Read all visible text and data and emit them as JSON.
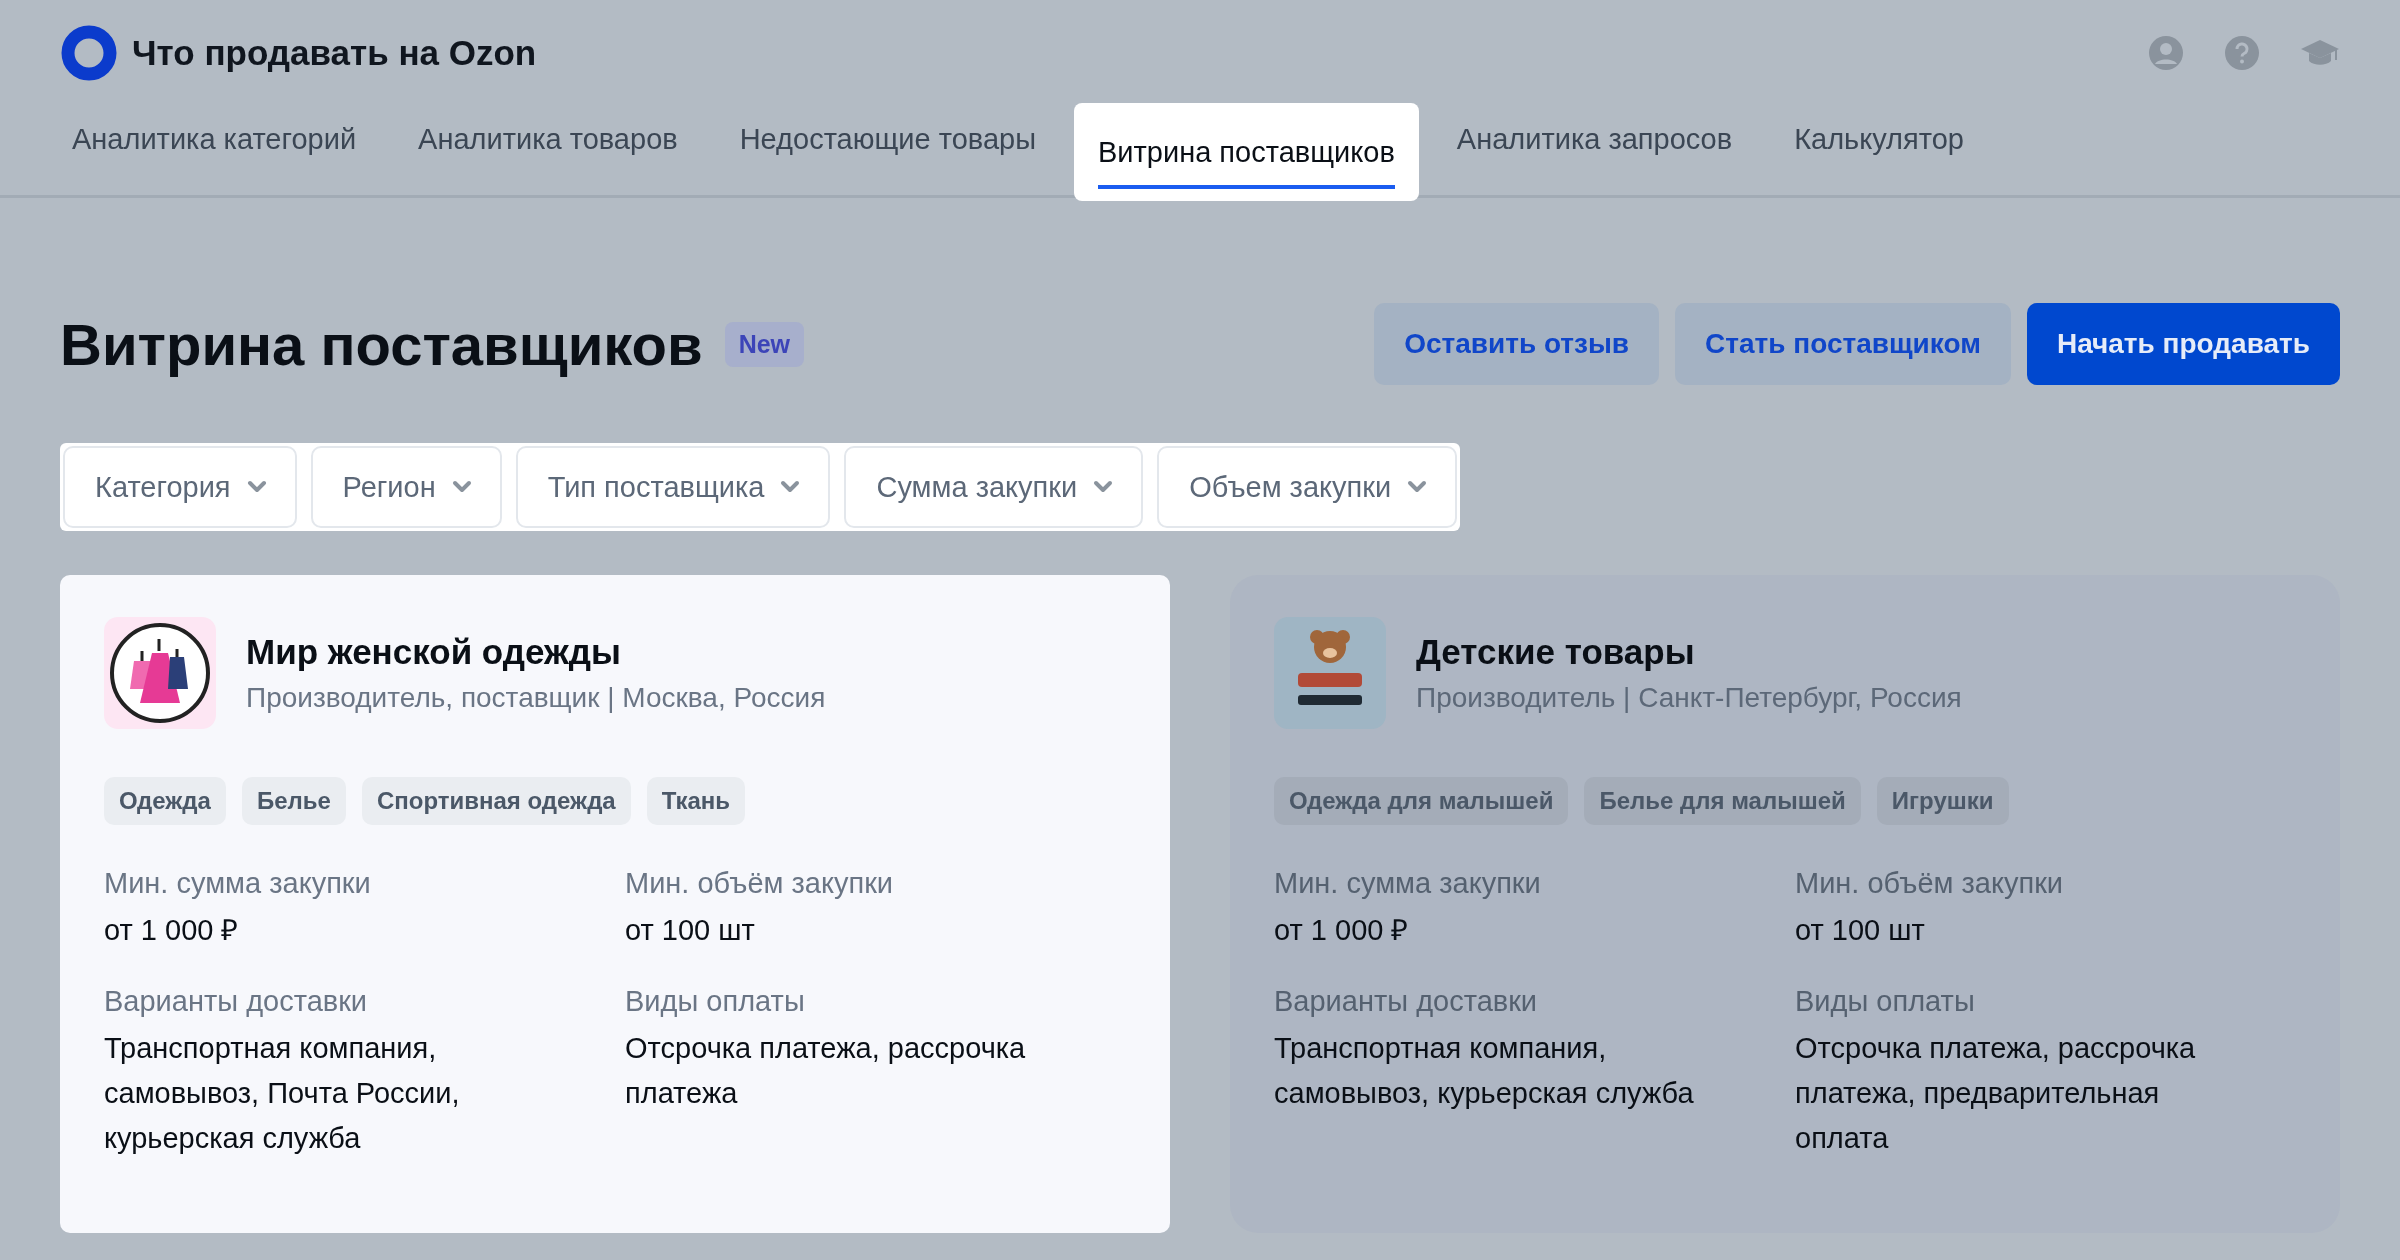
{
  "header": {
    "title": "Что продавать на Ozon"
  },
  "tabs": [
    {
      "label": "Аналитика категорий",
      "selected": false
    },
    {
      "label": "Аналитика товаров",
      "selected": false
    },
    {
      "label": "Недостающие товары",
      "selected": false
    },
    {
      "label": "Витрина поставщиков",
      "selected": true
    },
    {
      "label": "Аналитика запросов",
      "selected": false
    },
    {
      "label": "Калькулятор",
      "selected": false
    }
  ],
  "page": {
    "title": "Витрина поставщиков",
    "badge": "New"
  },
  "actions": [
    {
      "label": "Оставить отзыв",
      "kind": "secondary"
    },
    {
      "label": "Стать поставщиком",
      "kind": "secondary"
    },
    {
      "label": "Начать продавать",
      "kind": "primary"
    }
  ],
  "filters": {
    "spotlight": true,
    "items": [
      "Категория",
      "Регион",
      "Тип поставщика",
      "Сумма закупки",
      "Объем закупки"
    ]
  },
  "suppliers": [
    {
      "name": "Мир женской одежды",
      "subtitle": "Производитель, поставщик | Москва, Россия",
      "kind": "dresses",
      "spotlight": true,
      "tags": [
        "Одежда",
        "Белье",
        "Спортивная одежда",
        "Ткань"
      ],
      "fields": [
        {
          "label": "Мин. сумма закупки",
          "value": "от 1 000 ₽"
        },
        {
          "label": "Мин. объём закупки",
          "value": "от 100 шт"
        },
        {
          "label": "Варианты доставки",
          "value": "Транспортная компания, самовывоз, Почта России, курьерская служба"
        },
        {
          "label": "Виды оплаты",
          "value": "Отсрочка платежа, рассрочка платежа"
        }
      ]
    },
    {
      "name": "Детские товары",
      "subtitle": "Производитель | Санкт-Петербург, Россия",
      "kind": "bear",
      "spotlight": false,
      "tags": [
        "Одежда для малышей",
        "Белье для малышей",
        "Игрушки"
      ],
      "fields": [
        {
          "label": "Мин. сумма закупки",
          "value": "от 1 000 ₽"
        },
        {
          "label": "Мин. объём закупки",
          "value": "от 100 шт"
        },
        {
          "label": "Варианты доставки",
          "value": "Транспортная компания, самовывоз, курьерская служба"
        },
        {
          "label": "Виды оплаты",
          "value": "Отсрочка платежа, рассрочка платежа, предварительная оплата"
        }
      ]
    }
  ]
}
